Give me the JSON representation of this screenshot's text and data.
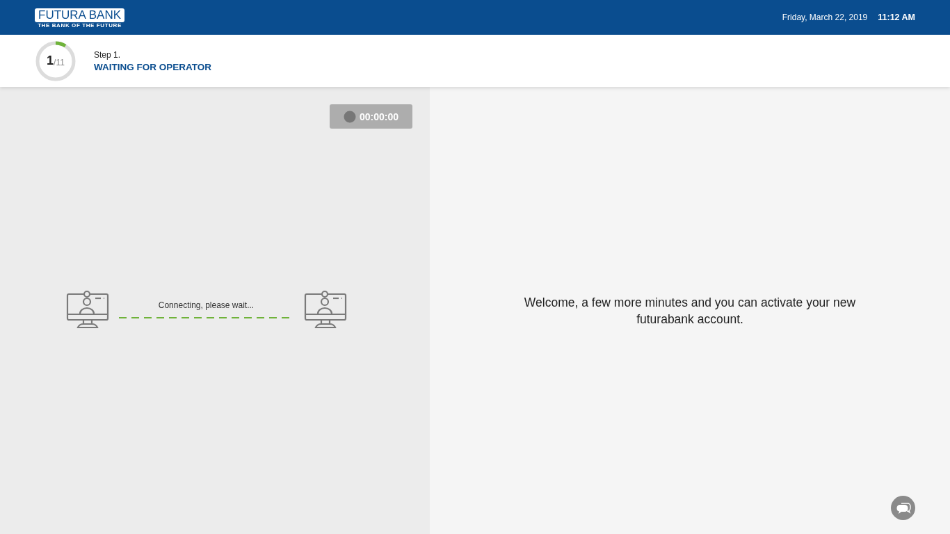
{
  "header": {
    "logo": {
      "name": "FUTURA BANK",
      "tagline": "THE BANK OF THE FUTURE"
    },
    "date": "Friday, March 22, 2019",
    "time": "11:12 AM"
  },
  "step": {
    "current": "1",
    "total": "/11",
    "level": 0.09,
    "label": "Step 1.",
    "title": "WAITING FOR OPERATOR"
  },
  "call": {
    "timer": "00:00:00",
    "status": "Connecting, please wait..."
  },
  "welcome": "Welcome, a few more minutes and you can activate your new futurabank account."
}
